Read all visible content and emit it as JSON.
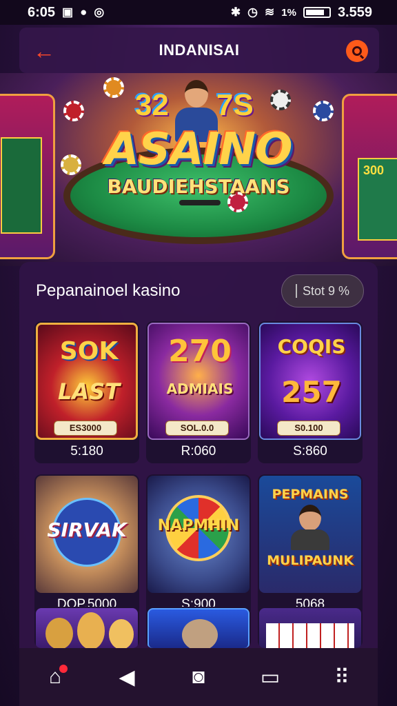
{
  "status_bar": {
    "time": "6:05",
    "right_text": "3.559",
    "battery_text": "1%"
  },
  "app_bar": {
    "title": "INDANISAI"
  },
  "hero": {
    "title": "ASAINO",
    "subtitle": "BAUDIEHSTAANS",
    "numbers_left": "32",
    "numbers_right": "7S",
    "slot_right_text": "300"
  },
  "section": {
    "title": "Pepanainoel kasino",
    "pill_label": "Stot 9 %"
  },
  "cards": [
    {
      "art_top": "SOK",
      "art_mid": "LAST",
      "tag": "ES3000",
      "value": "5:180",
      "theme": "red"
    },
    {
      "art_top": "270",
      "art_mid": "ADMIAIS",
      "tag": "SOL.0.0",
      "value": "R:060",
      "theme": "purple"
    },
    {
      "art_top": "COQIS",
      "art_mid": "257",
      "tag": "S0.100",
      "value": "S:860",
      "theme": "violet"
    },
    {
      "art_top": "",
      "art_mid": "SIRVAK",
      "tag": "",
      "value": "DOP.5000",
      "theme": "gold"
    },
    {
      "art_top": "",
      "art_mid": "NAPMHIN",
      "tag": "",
      "value": "S:900",
      "theme": "blue"
    },
    {
      "art_top": "PEPMAINS",
      "art_mid": "MULIPAUNK",
      "tag": "",
      "value": "5068",
      "theme": "navy"
    }
  ],
  "nav": {
    "home_icon": "home-icon",
    "back_icon": "back-triangle-icon",
    "search_icon": "search-icon",
    "tabs_icon": "tabs-icon",
    "menu_icon": "grid-menu-icon"
  },
  "colors": {
    "accent": "#ff4a2a",
    "background": "#2b1240",
    "panel": "#30144a"
  }
}
